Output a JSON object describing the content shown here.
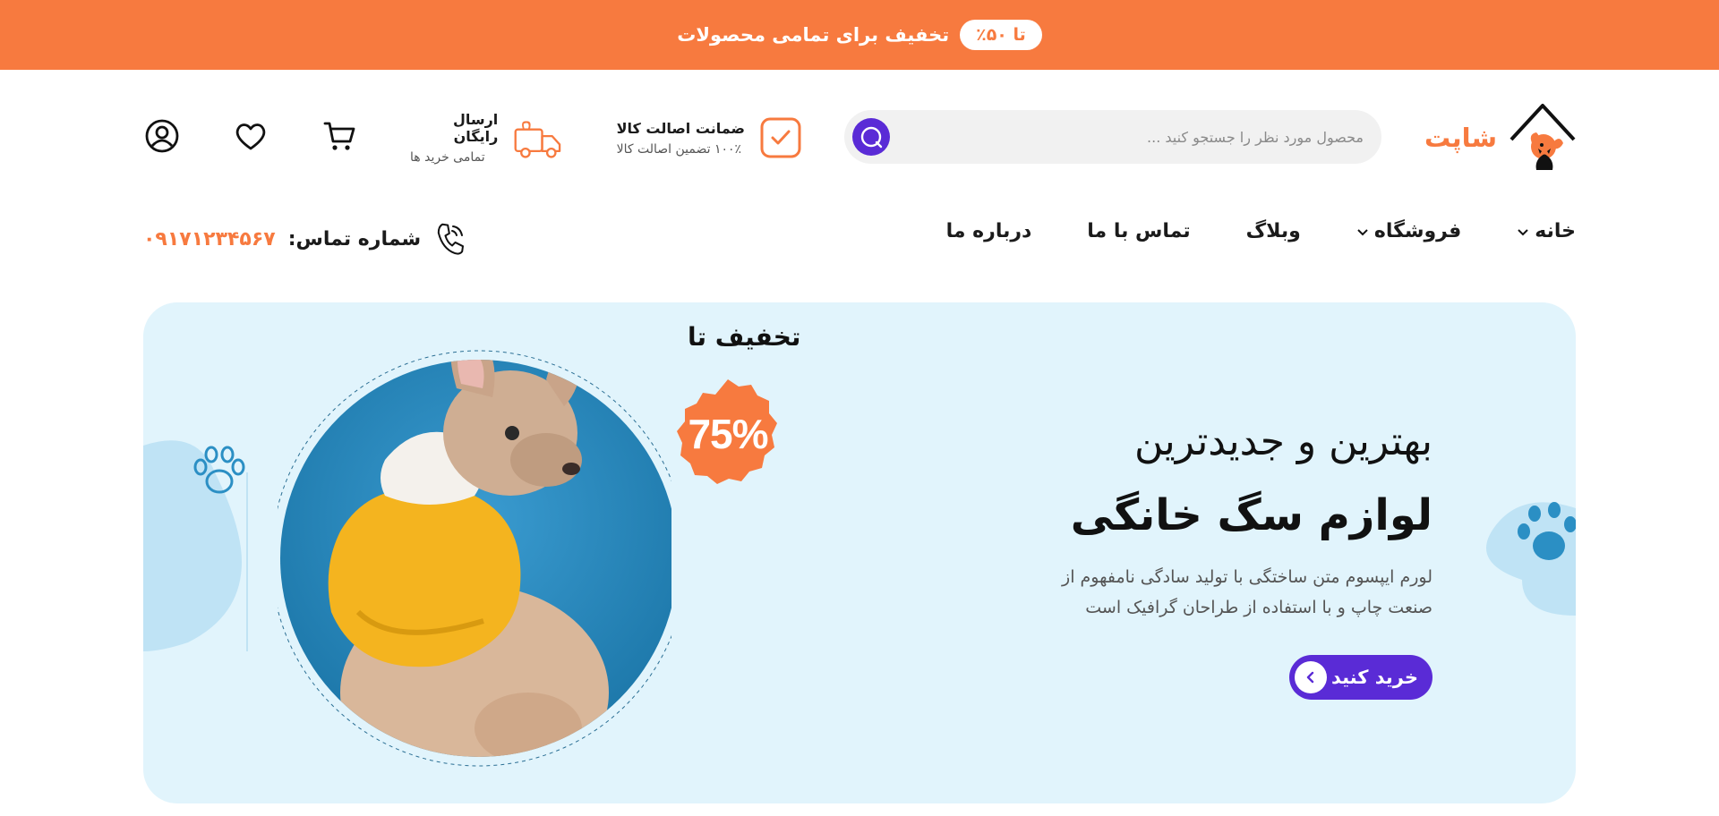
{
  "promo": {
    "pill": "تا ۵۰٪",
    "text": "تخفیف برای تمامی محصولات"
  },
  "brand": {
    "name": "شاپت"
  },
  "search": {
    "placeholder": "محصول مورد نظر را جستجو کنید ..."
  },
  "features": {
    "guarantee": {
      "title": "ضمانت اصالت کالا",
      "subtitle": "۱۰۰٪ تضمین اصالت کالا"
    },
    "shipping": {
      "title": "ارسال رایگان",
      "subtitle": "تمامی خرید ها"
    }
  },
  "header_icons": [
    "cart-icon",
    "heart-icon",
    "user-icon"
  ],
  "nav": {
    "items": [
      {
        "label": "خانه",
        "dropdown": true
      },
      {
        "label": "فروشگاه",
        "dropdown": true
      },
      {
        "label": "وبلاگ",
        "dropdown": false
      },
      {
        "label": "تماس با ما",
        "dropdown": false
      },
      {
        "label": "درباره ما",
        "dropdown": false
      }
    ],
    "contact_label": "شماره تماس:",
    "contact_phone": "۰۹۱۷۱۲۳۴۵۶۷"
  },
  "hero": {
    "title_line1": "بهترین و جدیدترین",
    "title_line2": "لوازم سگ خانگی",
    "description": "لورم ایپسوم متن ساختگی با تولید سادگی نامفهوم از صنعت چاپ و با استفاده از طراحان گرافیک است",
    "cta_label": "خرید کنید",
    "discount_label": "تخفیف تا",
    "discount_value": "75%"
  },
  "colors": {
    "brand_orange": "#f77a3f",
    "accent_purple": "#5a2bd6",
    "hero_bg": "#e1f4fc",
    "hero_blue": "#2b8fc4"
  }
}
